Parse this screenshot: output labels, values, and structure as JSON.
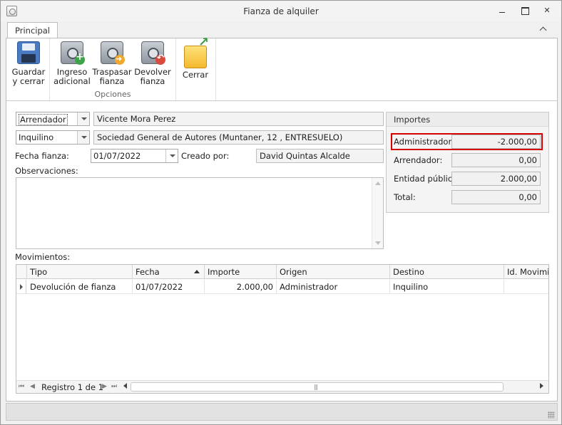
{
  "window": {
    "title": "Fianza de alquiler"
  },
  "ribbon": {
    "tab": "Principal",
    "buttons": {
      "guardar": {
        "line1": "Guardar",
        "line2": "y cerrar"
      },
      "ingreso": {
        "line1": "Ingreso",
        "line2": "adicional"
      },
      "traspasar": {
        "line1": "Traspasar",
        "line2": "fianza"
      },
      "devolver": {
        "line1": "Devolver",
        "line2": "fianza"
      },
      "cerrar": {
        "line1": "Cerrar"
      }
    },
    "group_label": "Opciones"
  },
  "form": {
    "party1": {
      "role": "Arrendador",
      "name": "Vicente Mora Perez"
    },
    "party2": {
      "role": "Inquilino",
      "name": "Sociedad General de Autores (Muntaner, 12 , ENTRESUELO)"
    },
    "fecha_label": "Fecha fianza:",
    "fecha_value": "01/07/2022",
    "creado_label": "Creado por:",
    "creado_value": "David Quintas Alcalde",
    "observaciones_label": "Observaciones:",
    "observaciones_value": ""
  },
  "importes": {
    "title": "Importes",
    "rows": [
      {
        "label": "Administrador:",
        "value": "-2.000,00",
        "highlighted": true
      },
      {
        "label": "Arrendador:",
        "value": "0,00"
      },
      {
        "label": "Entidad pública:",
        "value": "2.000,00"
      },
      {
        "label": "Total:",
        "value": "0,00"
      }
    ]
  },
  "movimientos": {
    "label": "Movimientos:",
    "columns": [
      "Tipo",
      "Fecha",
      "Importe",
      "Origen",
      "Destino",
      "Id. Movimiento"
    ],
    "sorted_column": "Fecha",
    "rows": [
      {
        "tipo": "Devolución de fianza",
        "fecha": "01/07/2022",
        "importe": "2.000,00",
        "origen": "Administrador",
        "destino": "Inquilino",
        "id": ""
      }
    ],
    "navigator": {
      "record_text": "Registro 1 de 1"
    }
  },
  "colors": {
    "highlight_border": "#d40000"
  }
}
